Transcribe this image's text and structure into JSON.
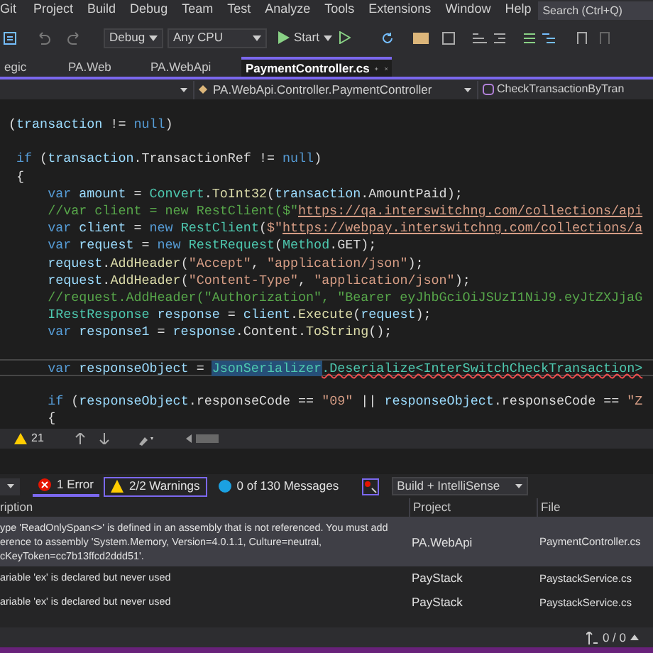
{
  "menu": [
    "Git",
    "Project",
    "Build",
    "Debug",
    "Team",
    "Test",
    "Analyze",
    "Tools",
    "Extensions",
    "Window",
    "Help"
  ],
  "search": {
    "placeholder": "Search (Ctrl+Q)"
  },
  "toolbar": {
    "configuration": "Debug",
    "platform": "Any CPU",
    "start": "Start"
  },
  "tabs": [
    {
      "label": "egic",
      "selected": false
    },
    {
      "label": "PA.Web",
      "selected": false
    },
    {
      "label": "PA.WebApi",
      "selected": false
    },
    {
      "label": "PaymentController.cs",
      "selected": true
    }
  ],
  "navigation": {
    "class": "PA.WebApi.Controller.PaymentController",
    "member": "CheckTransactionByTran"
  },
  "code": {
    "lines": [
      {
        "kind": "code",
        "current": false,
        "tokens": [
          {
            "kind": "plain",
            "text": "("
          },
          {
            "kind": "local",
            "text": "transaction"
          },
          {
            "kind": "plain",
            "text": " != "
          },
          {
            "kind": "kw",
            "text": "null"
          },
          {
            "kind": "plain",
            "text": ")"
          }
        ]
      },
      {
        "kind": "blank",
        "current": false
      },
      {
        "kind": "code",
        "current": false,
        "tokens": [
          {
            "kind": "kw",
            "text": " if"
          },
          {
            "kind": "plain",
            "text": " ("
          },
          {
            "kind": "local",
            "text": "transaction"
          },
          {
            "kind": "plain",
            "text": ".TransactionRef != "
          },
          {
            "kind": "kw",
            "text": "null"
          },
          {
            "kind": "plain",
            "text": ")"
          }
        ]
      },
      {
        "kind": "code",
        "current": false,
        "tokens": [
          {
            "kind": "plain",
            "text": " {"
          }
        ]
      },
      {
        "kind": "code",
        "current": false,
        "tokens": [
          {
            "kind": "kw",
            "text": "     var"
          },
          {
            "kind": "local",
            "text": " amount"
          },
          {
            "kind": "plain",
            "text": " = "
          },
          {
            "kind": "type",
            "text": "Convert"
          },
          {
            "kind": "plain",
            "text": "."
          },
          {
            "kind": "method",
            "text": "ToInt32"
          },
          {
            "kind": "plain",
            "text": "("
          },
          {
            "kind": "local",
            "text": "transaction"
          },
          {
            "kind": "plain",
            "text": ".AmountPaid);"
          }
        ]
      },
      {
        "kind": "code",
        "current": false,
        "tokens": [
          {
            "kind": "comment",
            "text": "     //var client = new RestClient($\""
          },
          {
            "kind": "url",
            "text": "https://qa.interswitchng.com/collections/api"
          }
        ]
      },
      {
        "kind": "code",
        "current": false,
        "tokens": [
          {
            "kind": "kw",
            "text": "     var"
          },
          {
            "kind": "local",
            "text": " client"
          },
          {
            "kind": "plain",
            "text": " = "
          },
          {
            "kind": "kw",
            "text": "new"
          },
          {
            "kind": "type",
            "text": " RestClient"
          },
          {
            "kind": "plain",
            "text": "("
          },
          {
            "kind": "str",
            "text": "$\""
          },
          {
            "kind": "url",
            "text": "https://webpay.interswitchng.com/collections/a"
          }
        ]
      },
      {
        "kind": "code",
        "current": false,
        "tokens": [
          {
            "kind": "kw",
            "text": "     var"
          },
          {
            "kind": "local",
            "text": " request"
          },
          {
            "kind": "plain",
            "text": " = "
          },
          {
            "kind": "kw",
            "text": "new"
          },
          {
            "kind": "type",
            "text": " RestRequest"
          },
          {
            "kind": "plain",
            "text": "("
          },
          {
            "kind": "type",
            "text": "Method"
          },
          {
            "kind": "plain",
            "text": ".GET);"
          }
        ]
      },
      {
        "kind": "code",
        "current": false,
        "tokens": [
          {
            "kind": "local",
            "text": "     request"
          },
          {
            "kind": "plain",
            "text": "."
          },
          {
            "kind": "method",
            "text": "AddHeader"
          },
          {
            "kind": "plain",
            "text": "("
          },
          {
            "kind": "str",
            "text": "\"Accept\""
          },
          {
            "kind": "plain",
            "text": ", "
          },
          {
            "kind": "str",
            "text": "\"application/json\""
          },
          {
            "kind": "plain",
            "text": ");"
          }
        ]
      },
      {
        "kind": "code",
        "current": false,
        "tokens": [
          {
            "kind": "local",
            "text": "     request"
          },
          {
            "kind": "plain",
            "text": "."
          },
          {
            "kind": "method",
            "text": "AddHeader"
          },
          {
            "kind": "plain",
            "text": "("
          },
          {
            "kind": "str",
            "text": "\"Content-Type\""
          },
          {
            "kind": "plain",
            "text": ", "
          },
          {
            "kind": "str",
            "text": "\"application/json\""
          },
          {
            "kind": "plain",
            "text": ");"
          }
        ]
      },
      {
        "kind": "code",
        "current": false,
        "tokens": [
          {
            "kind": "comment",
            "text": "     //request.AddHeader(\"Authorization\", \"Bearer eyJhbGciOiJSUzI1NiJ9.eyJtZXJjaG"
          }
        ]
      },
      {
        "kind": "code",
        "current": false,
        "tokens": [
          {
            "kind": "type",
            "text": "     IRestResponse"
          },
          {
            "kind": "local",
            "text": " response"
          },
          {
            "kind": "plain",
            "text": " = "
          },
          {
            "kind": "local",
            "text": "client"
          },
          {
            "kind": "plain",
            "text": "."
          },
          {
            "kind": "method",
            "text": "Execute"
          },
          {
            "kind": "plain",
            "text": "("
          },
          {
            "kind": "local",
            "text": "request"
          },
          {
            "kind": "plain",
            "text": ");"
          }
        ]
      },
      {
        "kind": "code",
        "current": false,
        "tokens": [
          {
            "kind": "kw",
            "text": "     var"
          },
          {
            "kind": "local",
            "text": " response1"
          },
          {
            "kind": "plain",
            "text": " = "
          },
          {
            "kind": "local",
            "text": "response"
          },
          {
            "kind": "plain",
            "text": ".Content."
          },
          {
            "kind": "method",
            "text": "ToString"
          },
          {
            "kind": "plain",
            "text": "();"
          }
        ]
      },
      {
        "kind": "blank",
        "current": false
      },
      {
        "kind": "code",
        "current": true,
        "tokens": [
          {
            "kind": "kw",
            "text": "     var"
          },
          {
            "kind": "local",
            "text": " responseObject"
          },
          {
            "kind": "plain",
            "text": " = "
          },
          {
            "kind": "highlight",
            "text": "JsonSerializer"
          },
          {
            "kind": "error",
            "text": ".Deserialize<InterSwitchCheckTransaction>"
          }
        ]
      },
      {
        "kind": "blank",
        "current": false
      },
      {
        "kind": "code",
        "current": false,
        "tokens": [
          {
            "kind": "kw",
            "text": "     if"
          },
          {
            "kind": "plain",
            "text": " ("
          },
          {
            "kind": "local",
            "text": "responseObject"
          },
          {
            "kind": "plain",
            "text": ".responseCode == "
          },
          {
            "kind": "str",
            "text": "\"09\""
          },
          {
            "kind": "plain",
            "text": " || "
          },
          {
            "kind": "local",
            "text": "responseObject"
          },
          {
            "kind": "plain",
            "text": ".responseCode == "
          },
          {
            "kind": "str",
            "text": "\"Z"
          }
        ]
      },
      {
        "kind": "code",
        "current": false,
        "tokens": [
          {
            "kind": "plain",
            "text": "     {"
          }
        ]
      }
    ]
  },
  "editor_status": {
    "warnings": "21"
  },
  "error_list": {
    "filters": [
      {
        "kind": "error",
        "label": "1 Error",
        "selected": true
      },
      {
        "kind": "warning",
        "label": "2/2 Warnings",
        "selected": true
      },
      {
        "kind": "message",
        "label": "0 of 130 Messages",
        "selected": false
      }
    ],
    "scope": "Build + IntelliSense",
    "columns": [
      "ription",
      "Project",
      "File"
    ],
    "rows": [
      {
        "selected": true,
        "description": [
          "ype 'ReadOnlySpan<>' is defined in an assembly that is not referenced. You must add",
          "erence to assembly 'System.Memory, Version=4.0.1.1, Culture=neutral,",
          "cKeyToken=cc7b13ffcd2ddd51'."
        ],
        "project": "PA.WebApi",
        "file": "PaymentController.cs"
      },
      {
        "selected": false,
        "description": [
          "ariable 'ex' is declared but never used"
        ],
        "project": "PayStack",
        "file": "PaystackService.cs"
      },
      {
        "selected": false,
        "description": [
          "ariable 'ex' is declared but never used"
        ],
        "project": "PayStack",
        "file": "PaystackService.cs"
      }
    ]
  },
  "status_bar": {
    "position": "0 / 0"
  }
}
